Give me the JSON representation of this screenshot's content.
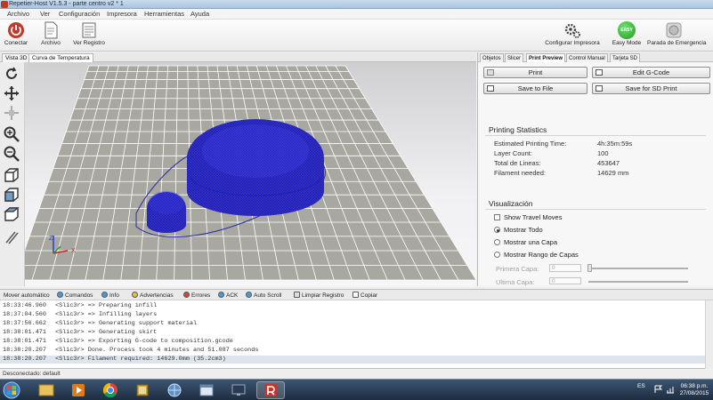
{
  "window": {
    "title": "Repetier-Host V1.5.3 - parte centro v2 * 1"
  },
  "menu": [
    "Archivo",
    "Ver",
    "Configuración",
    "Impresora",
    "Herramientas",
    "Ayuda"
  ],
  "toolbar": {
    "connect": "Conectar",
    "file": "Archivo",
    "log": "Ver Registro",
    "printer_settings": "Configurar Impresora",
    "easy_mode": "Easy Mode",
    "easy_badge": "EASY",
    "emergency": "Parada de Emergencia"
  },
  "view_tabs": [
    "Vista 3D",
    "Curva de Temperatura"
  ],
  "right_tabs": [
    "Objetos",
    "Slicer",
    "Print Preview",
    "Control Manual",
    "Tarjeta SD"
  ],
  "buttons": {
    "print": "Print",
    "edit_gcode": "Edit G-Code",
    "save_file": "Save to File",
    "save_sd": "Save for SD Print"
  },
  "stats": {
    "title": "Printing Statistics",
    "rows": [
      {
        "label": "Estimated Printing Time:",
        "value": "4h:35m:59s"
      },
      {
        "label": "Layer Count:",
        "value": "100"
      },
      {
        "label": "Total de Lineas:",
        "value": "453647"
      },
      {
        "label": "Filament needed:",
        "value": "14629 mm"
      }
    ]
  },
  "visualization": {
    "title": "Visualización",
    "show_travel": "Show Travel Moves",
    "show_all": "Mostrar Todo",
    "show_layer": "Mostrar una Capa",
    "show_range": "Mostrar Rango de Capas",
    "first_layer_label": "Primera Capa:",
    "first_layer_value": "0",
    "last_layer_label": "Ultima Capa:",
    "last_layer_value": "0"
  },
  "log_tabs": {
    "auto_scroll_label": "Mover automático",
    "commands": "Comandos",
    "info": "Info",
    "warnings": "Advertencias",
    "errors": "Errores",
    "ack": "ACK",
    "autoscroll": "Auto Scroll",
    "clear": "Limpiar Registro",
    "copy": "Copiar"
  },
  "log": [
    {
      "time": "18:33:46.960",
      "msg": "<Slic3r> => Preparing infill"
    },
    {
      "time": "18:37:04.560",
      "msg": "<Slic3r> => Infilling layers"
    },
    {
      "time": "18:37:56.662",
      "msg": "<Slic3r> => Generating support material"
    },
    {
      "time": "18:38:01.471",
      "msg": "<Slic3r> => Generating skirt"
    },
    {
      "time": "18:38:01.471",
      "msg": "<Slic3r> => Exporting G-code to composition.gcode"
    },
    {
      "time": "18:38:20.207",
      "msg": "<Slic3r> Done. Process took 4 minutes and 51.087 seconds"
    },
    {
      "time": "18:38:20.207",
      "msg": "<Slic3r> Filament required: 14629.0mm (35.2cm3)"
    }
  ],
  "status": "Desconectado: default",
  "tray": {
    "lang": "ES",
    "time": "06:38 p.m.",
    "date": "27/08/2015"
  },
  "colors": {
    "model_blue": "#3030d8",
    "grid_fill": "#a8a8a0",
    "grid_line": "#ffffff"
  }
}
